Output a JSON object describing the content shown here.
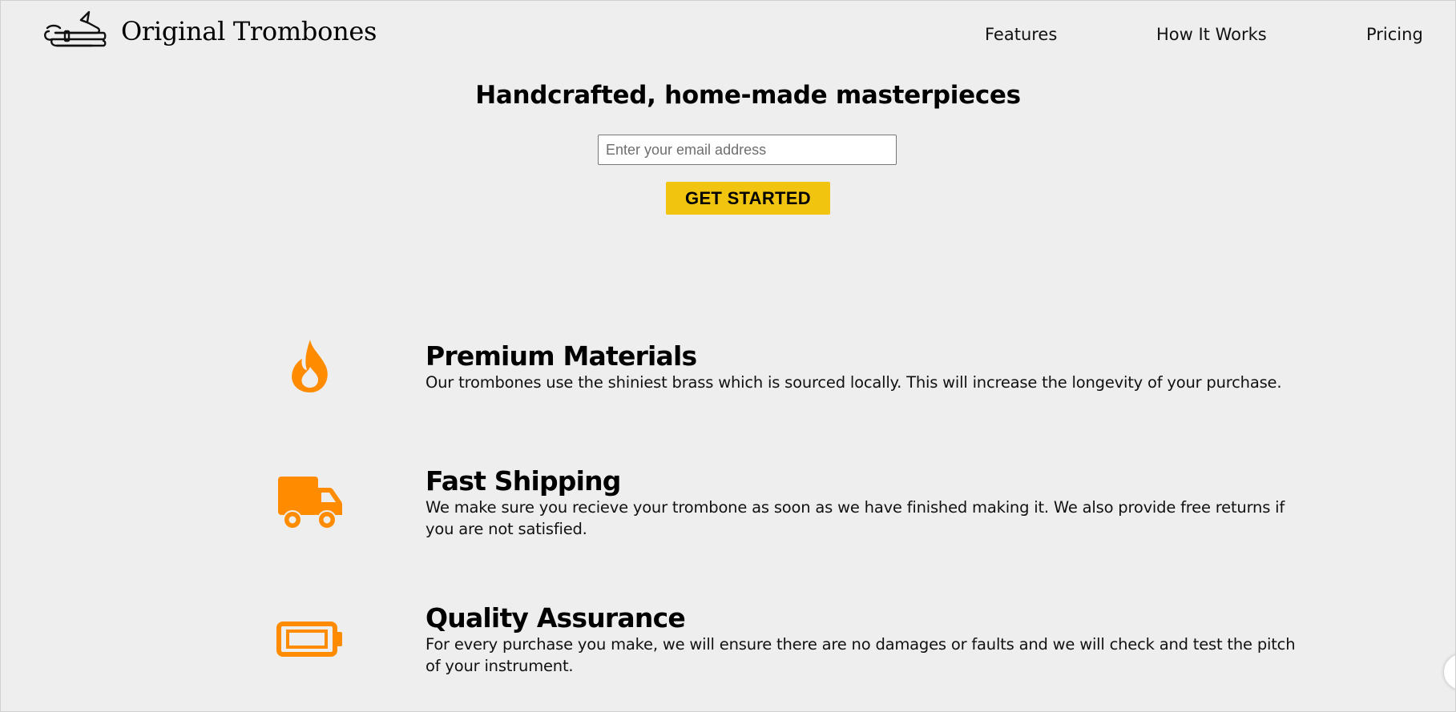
{
  "header": {
    "brand": "Original Trombones",
    "logo_icon": "trombone-icon",
    "nav": {
      "features": "Features",
      "how_it_works": "How It Works",
      "pricing": "Pricing"
    }
  },
  "hero": {
    "title": "Handcrafted, home-made masterpieces",
    "email_placeholder": "Enter your email address",
    "email_value": "",
    "cta_label": "GET STARTED"
  },
  "features": [
    {
      "icon": "fire-icon",
      "title": "Premium Materials",
      "description": "Our trombones use the shiniest brass which is sourced locally. This will increase the longevity of your purchase."
    },
    {
      "icon": "truck-icon",
      "title": "Fast Shipping",
      "description": "We make sure you recieve your trombone as soon as we have finished making it. We also provide free returns if you are not satisfied."
    },
    {
      "icon": "battery-icon",
      "title": "Quality Assurance",
      "description": "For every purchase you make, we will ensure there are no damages or faults and we will check and test the pitch of your instrument."
    }
  ],
  "colors": {
    "background": "#eeeeee",
    "accent_icon": "#ff8c00",
    "cta": "#f1c40f"
  }
}
